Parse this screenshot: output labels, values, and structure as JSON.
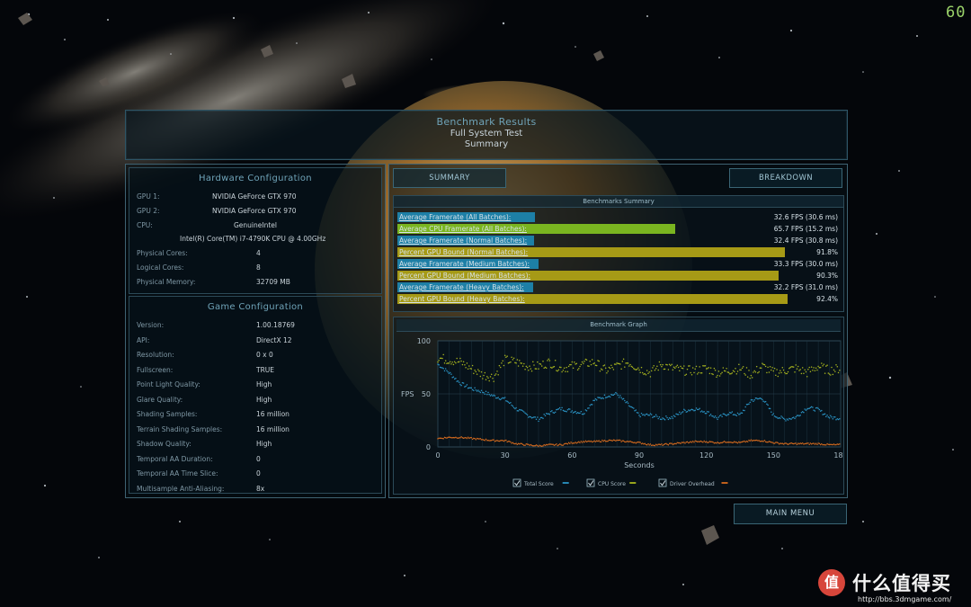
{
  "fps_counter": "60",
  "header": {
    "title": "Benchmark Results",
    "subtitle": "Full System Test",
    "section": "Summary"
  },
  "hardware": {
    "title": "Hardware Configuration",
    "gpu1_label": "GPU 1:",
    "gpu1_value": "NVIDIA GeForce GTX 970",
    "gpu2_label": "GPU 2:",
    "gpu2_value": "NVIDIA GeForce GTX 970",
    "cpu_label": "CPU:",
    "cpu_value": "GenuineIntel",
    "cpu_model": "Intel(R) Core(TM) i7-4790K CPU @ 4.00GHz",
    "physical_cores_label": "Physical Cores:",
    "physical_cores_value": "4",
    "logical_cores_label": "Logical Cores:",
    "logical_cores_value": "8",
    "memory_label": "Physical Memory:",
    "memory_value": "32709  MB"
  },
  "game_config": {
    "title": "Game Configuration",
    "rows": [
      {
        "key": "Version:",
        "value": "1.00.18769"
      },
      {
        "key": "API:",
        "value": "DirectX 12"
      },
      {
        "key": "Resolution:",
        "value": "0 x 0"
      },
      {
        "key": "Fullscreen:",
        "value": "TRUE"
      },
      {
        "key": "Point Light Quality:",
        "value": "High"
      },
      {
        "key": "Glare Quality:",
        "value": "High"
      },
      {
        "key": "Shading Samples:",
        "value": "16 million"
      },
      {
        "key": "Terrain Shading Samples:",
        "value": "16 million"
      },
      {
        "key": "Shadow Quality:",
        "value": "High"
      },
      {
        "key": "Temporal AA Duration:",
        "value": "0"
      },
      {
        "key": "Temporal AA Time Slice:",
        "value": "0"
      },
      {
        "key": "Multisample Anti-Aliasing:",
        "value": "8x"
      }
    ]
  },
  "tabs": {
    "summary": "SUMMARY",
    "breakdown": "BREAKDOWN"
  },
  "benchmarks_summary": {
    "title": "Benchmarks Summary",
    "rows": [
      {
        "label": "Average Framerate (All Batches):",
        "value": "32.6 FPS (30.6 ms)",
        "fill": 0.326,
        "color": "#1d7fa6"
      },
      {
        "label": "Average CPU Framerate (All Batches):",
        "value": "65.7 FPS (15.2 ms)",
        "fill": 0.657,
        "color": "#7ab520"
      },
      {
        "label": "Average Framerate (Normal Batches):",
        "value": "32.4 FPS (30.8 ms)",
        "fill": 0.324,
        "color": "#1d7fa6"
      },
      {
        "label": "Percent GPU Bound (Normal Batches):",
        "value": "91.8%",
        "fill": 0.918,
        "color": "#a69a16"
      },
      {
        "label": "Average Framerate (Medium Batches):",
        "value": "33.3 FPS (30.0 ms)",
        "fill": 0.333,
        "color": "#1d7fa6"
      },
      {
        "label": "Percent GPU Bound (Medium Batches):",
        "value": "90.3%",
        "fill": 0.903,
        "color": "#a69a16"
      },
      {
        "label": "Average Framerate (Heavy Batches):",
        "value": "32.2 FPS (31.0 ms)",
        "fill": 0.322,
        "color": "#1d7fa6"
      },
      {
        "label": "Percent GPU Bound (Heavy Batches):",
        "value": "92.4%",
        "fill": 0.924,
        "color": "#a69a16"
      }
    ]
  },
  "graph": {
    "title": "Benchmark Graph",
    "ylabel": "FPS",
    "xlabel": "Seconds",
    "legend": [
      {
        "label": "Total Score",
        "color": "#2a93c4"
      },
      {
        "label": "CPU Score",
        "color": "#a8b51e"
      },
      {
        "label": "Driver Overhead",
        "color": "#d46a1e"
      }
    ]
  },
  "chart_data": {
    "type": "scatter",
    "title": "Benchmark Graph",
    "xlabel": "Seconds",
    "ylabel": "FPS",
    "xlim": [
      0,
      180
    ],
    "ylim": [
      0,
      100
    ],
    "xticks": [
      0,
      30,
      60,
      90,
      120,
      150,
      180
    ],
    "yticks": [
      0,
      50,
      100
    ],
    "grid": true,
    "legend_position": "bottom",
    "series": [
      {
        "name": "Total Score",
        "color": "#2a93c4",
        "x": [
          0,
          5,
          10,
          15,
          20,
          25,
          30,
          35,
          40,
          45,
          50,
          55,
          60,
          65,
          70,
          75,
          80,
          85,
          90,
          95,
          100,
          105,
          110,
          115,
          120,
          125,
          130,
          135,
          140,
          145,
          150,
          155,
          160,
          165,
          170,
          175,
          180
        ],
        "y": [
          78,
          70,
          60,
          55,
          52,
          48,
          45,
          36,
          30,
          26,
          32,
          36,
          34,
          32,
          44,
          48,
          50,
          40,
          30,
          30,
          27,
          28,
          34,
          36,
          33,
          27,
          32,
          30,
          44,
          46,
          30,
          26,
          28,
          37,
          35,
          28,
          27
        ]
      },
      {
        "name": "CPU Score",
        "color": "#a8b51e",
        "x": [
          0,
          5,
          10,
          15,
          20,
          25,
          30,
          35,
          40,
          45,
          50,
          55,
          60,
          65,
          70,
          75,
          80,
          85,
          90,
          95,
          100,
          105,
          110,
          115,
          120,
          125,
          130,
          135,
          140,
          145,
          150,
          155,
          160,
          165,
          170,
          175,
          180
        ],
        "y": [
          84,
          82,
          80,
          74,
          68,
          66,
          82,
          80,
          76,
          76,
          80,
          74,
          76,
          78,
          80,
          72,
          76,
          80,
          74,
          70,
          78,
          74,
          72,
          72,
          74,
          70,
          72,
          74,
          68,
          76,
          70,
          72,
          74,
          70,
          76,
          72,
          74
        ]
      },
      {
        "name": "Driver Overhead",
        "color": "#d46a1e",
        "x": [
          0,
          5,
          10,
          15,
          20,
          25,
          30,
          35,
          40,
          45,
          50,
          55,
          60,
          65,
          70,
          75,
          80,
          85,
          90,
          95,
          100,
          105,
          110,
          115,
          120,
          125,
          130,
          135,
          140,
          145,
          150,
          155,
          160,
          165,
          170,
          175,
          180
        ],
        "y": [
          8,
          9,
          9,
          8,
          7,
          6,
          6,
          3,
          2,
          1,
          2,
          2,
          4,
          5,
          5,
          6,
          6,
          5,
          4,
          2,
          2,
          3,
          4,
          5,
          5,
          4,
          5,
          4,
          6,
          6,
          4,
          3,
          3,
          3,
          3,
          2,
          2
        ]
      }
    ]
  },
  "main_menu": "MAIN MENU",
  "watermark": {
    "logo_glyph": "值",
    "text": "什么值得买",
    "url": "http://bbs.3dmgame.com/"
  }
}
